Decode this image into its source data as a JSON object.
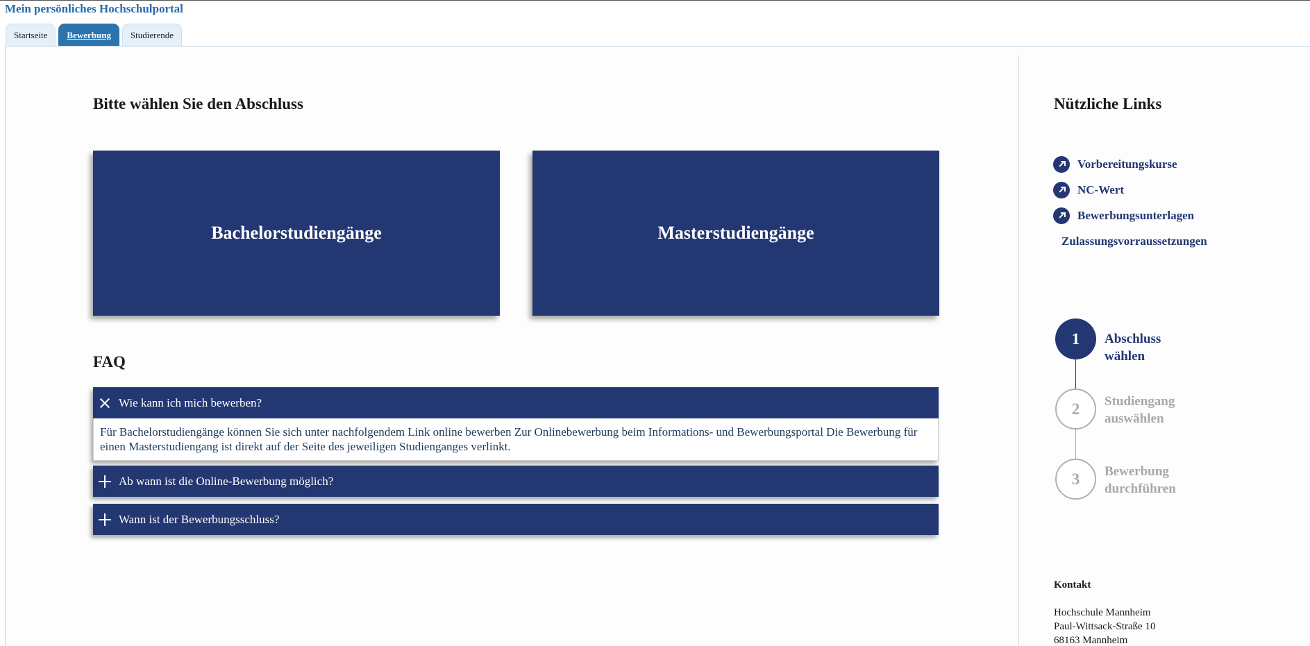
{
  "portal_title": "Mein persönliches Hochschulportal",
  "tabs": [
    {
      "label": "Startseite",
      "active": false
    },
    {
      "label": "Bewerbung",
      "active": true
    },
    {
      "label": "Studierende",
      "active": false
    }
  ],
  "main": {
    "heading": "Bitte wählen Sie den Abschluss",
    "cards": [
      {
        "label": "Bachelorstudiengänge"
      },
      {
        "label": "Masterstudiengänge"
      }
    ],
    "faq_heading": "FAQ",
    "faq": [
      {
        "question": "Wie kann ich mich bewerben?",
        "expanded": true,
        "icon": "close-icon",
        "answer": "Für Bachelorstudiengänge können Sie sich unter nachfolgendem Link online bewerben Zur Onlinebewerbung beim Informations- und Bewerbungsportal Die Bewerbung für einen Masterstudiengang ist direkt auf der Seite des jeweiligen Studienganges verlinkt."
      },
      {
        "question": "Ab wann ist die Online-Bewerbung möglich?",
        "expanded": false,
        "icon": "plus-icon"
      },
      {
        "question": "Wann ist der Bewerbungsschluss?",
        "expanded": false,
        "icon": "plus-icon"
      }
    ]
  },
  "sidebar": {
    "links_heading": "Nützliche Links",
    "links": [
      {
        "label": "Vorbereitungskurse",
        "icon": "external-link-icon"
      },
      {
        "label": "NC-Wert",
        "icon": "external-link-icon"
      },
      {
        "label": "Bewerbungsunterlagen",
        "icon": "external-link-icon"
      },
      {
        "label": "Zulassungsvorraussetzungen"
      }
    ],
    "steps": [
      {
        "number": "1",
        "label": "Abschluss wählen",
        "active": true
      },
      {
        "number": "2",
        "label": "Studiengang auswählen",
        "active": false
      },
      {
        "number": "3",
        "label": "Bewerbung durchführen",
        "active": false
      }
    ],
    "contact": {
      "title": "Kontakt",
      "lines": [
        "Hochschule Mannheim",
        "Paul-Wittsack-Straße 10",
        "68163 Mannheim"
      ]
    }
  },
  "colors": {
    "primary": "#233772",
    "tab_active": "#2a73ad",
    "title": "#2a6aa8",
    "inactive": "#a8a8a8"
  }
}
